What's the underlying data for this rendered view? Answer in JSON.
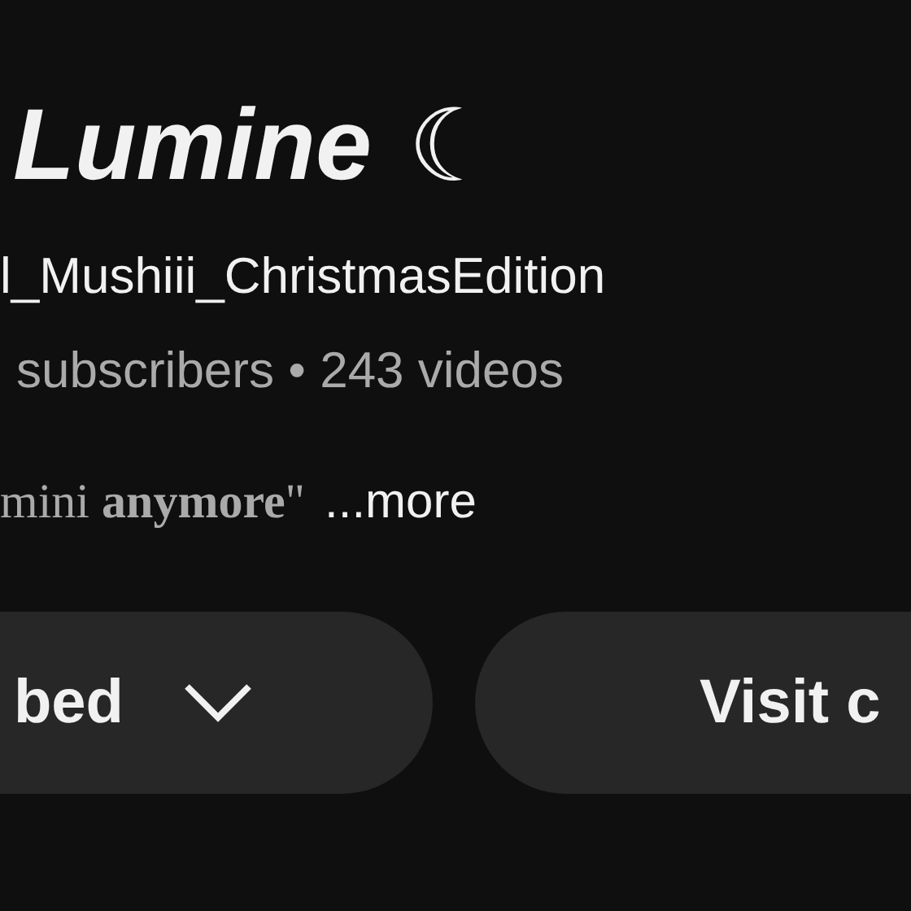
{
  "channel": {
    "name": "Lumine",
    "name_symbol": "☾",
    "handle": "l_Mushiii_ChristmasEdition",
    "stats": "subscribers • 243 videos",
    "description": "mini **anymore**\"",
    "more_link": "...more"
  },
  "buttons": [
    {
      "kind": "dropdown",
      "label": "bed"
    },
    {
      "kind": "plain",
      "label": "Visit c"
    }
  ]
}
